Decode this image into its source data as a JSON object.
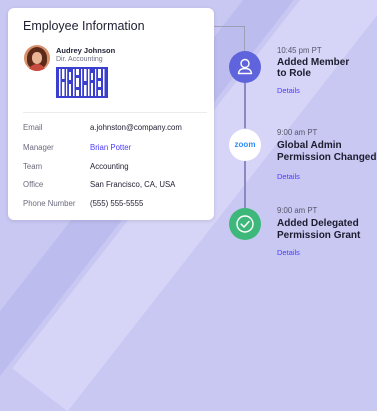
{
  "card": {
    "title": "Employee Information",
    "name": "Audrey Johnson",
    "role": "Dir. Accounting",
    "fields": [
      {
        "label": "Email",
        "value": "a.johnston@company.com",
        "link": false
      },
      {
        "label": "Manager",
        "value": "Brian Potter",
        "link": true
      },
      {
        "label": "Team",
        "value": "Accounting",
        "link": false
      },
      {
        "label": "Office",
        "value": "San Francisco, CA, USA",
        "link": false
      },
      {
        "label": "Phone Number",
        "value": "(555) 555-5555",
        "link": false
      }
    ]
  },
  "timeline": {
    "events": [
      {
        "time": "10:45 pm PT",
        "title_line1": "Added Member",
        "title_line2": "to Role",
        "link": "Details",
        "icon": "user-icon"
      },
      {
        "time": "9:00 am PT",
        "title_line1": "Global Admin",
        "title_line2": "Permission Changed",
        "link": "Details",
        "icon": "zoom-logo",
        "icon_text": "zoom"
      },
      {
        "time": "9:00 am PT",
        "title_line1": "Added Delegated",
        "title_line2": "Permission Grant",
        "link": "Details",
        "icon": "check-icon"
      }
    ]
  },
  "colors": {
    "background": "#c9c8f3",
    "accent": "#4b3cff",
    "user_node": "#5f63dc",
    "check_node": "#3eb87a",
    "zoom_blue": "#2d8cff"
  }
}
